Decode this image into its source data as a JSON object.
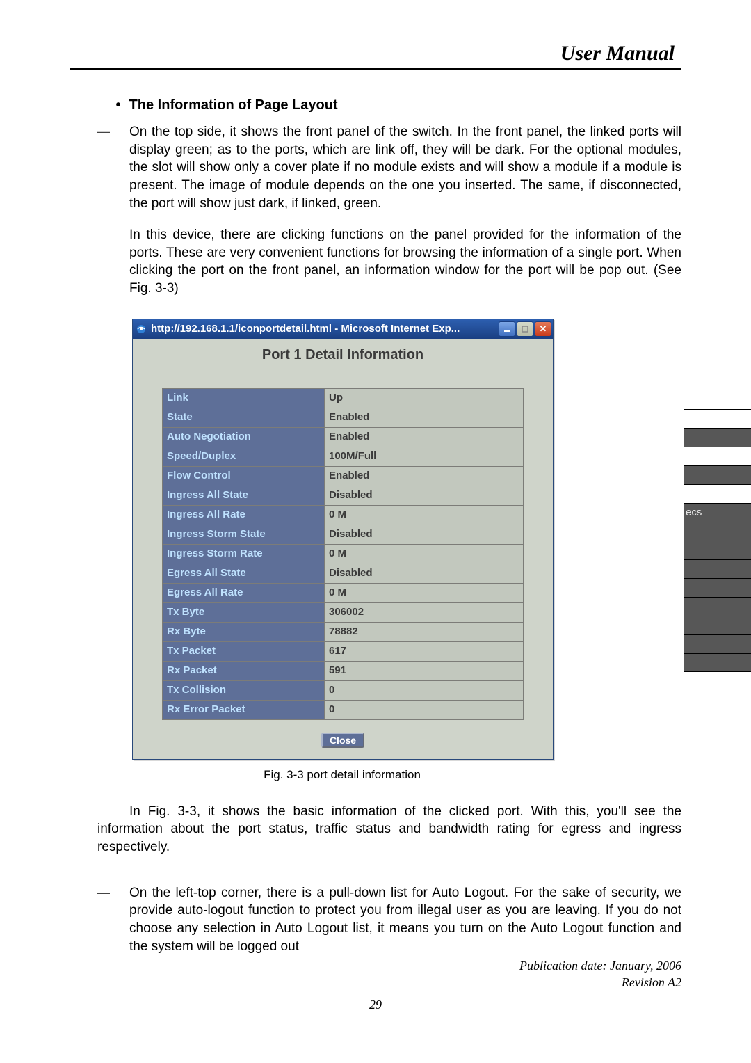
{
  "header": {
    "title": "User Manual"
  },
  "section": {
    "heading_bullet": "•",
    "heading": "The Information of Page Layout",
    "dash1": "—",
    "para1": "On the top side, it shows the front panel of the switch. In the front panel, the linked ports will display green; as to the ports, which are link off, they will be dark. For the optional modules, the slot will show only a cover plate if no module exists and will show a module if a module is present. The image of module depends on the one you inserted. The same, if disconnected, the port will show just dark, if linked, green.",
    "para2": "In this device, there are clicking functions on the panel provided for the information of the ports. These are very convenient functions for browsing the information of a single port. When clicking the port on the front panel, an information window for the port will be pop out. (See Fig. 3-3)",
    "caption": "Fig. 3-3 port detail information",
    "para3": "In Fig. 3-3, it shows the basic information of the clicked port. With this, you'll see the information about the port status, traffic status and bandwidth rating for egress and ingress respectively.",
    "dash2": "—",
    "para4": "On the left-top corner, there is a pull-down list for Auto Logout. For the sake of security, we provide auto-logout function to protect you from illegal user as you are leaving. If you do not choose any selection in Auto Logout list, it means you turn on the Auto Logout function and the system will be logged out"
  },
  "window": {
    "title": "http://192.168.1.1/iconportdetail.html - Microsoft Internet Exp...",
    "heading": "Port 1  Detail Information",
    "close_label": "Close",
    "rows": {
      "r0": {
        "label": "Link",
        "value": "Up"
      },
      "r1": {
        "label": "State",
        "value": "Enabled"
      },
      "r2": {
        "label": "Auto Negotiation",
        "value": "Enabled"
      },
      "r3": {
        "label": "Speed/Duplex",
        "value": "100M/Full"
      },
      "r4": {
        "label": "Flow Control",
        "value": "Enabled"
      },
      "r5": {
        "label": "Ingress All State",
        "value": "Disabled"
      },
      "r6": {
        "label": "Ingress All Rate",
        "value": "0 M"
      },
      "r7": {
        "label": "Ingress Storm State",
        "value": "Disabled"
      },
      "r8": {
        "label": "Ingress Storm Rate",
        "value": "0 M"
      },
      "r9": {
        "label": "Egress All State",
        "value": "Disabled"
      },
      "r10": {
        "label": "Egress All Rate",
        "value": "0 M"
      },
      "r11": {
        "label": "Tx Byte",
        "value": "306002"
      },
      "r12": {
        "label": "Rx Byte",
        "value": "78882"
      },
      "r13": {
        "label": "Tx Packet",
        "value": "617"
      },
      "r14": {
        "label": "Rx Packet",
        "value": "591"
      },
      "r15": {
        "label": "Tx Collision",
        "value": "0"
      },
      "r16": {
        "label": "Rx Error Packet",
        "value": "0"
      }
    }
  },
  "ghost": {
    "ecs": "ecs"
  },
  "footer": {
    "pub": "Publication date: January, 2006",
    "rev": "Revision A2",
    "page": "29"
  }
}
